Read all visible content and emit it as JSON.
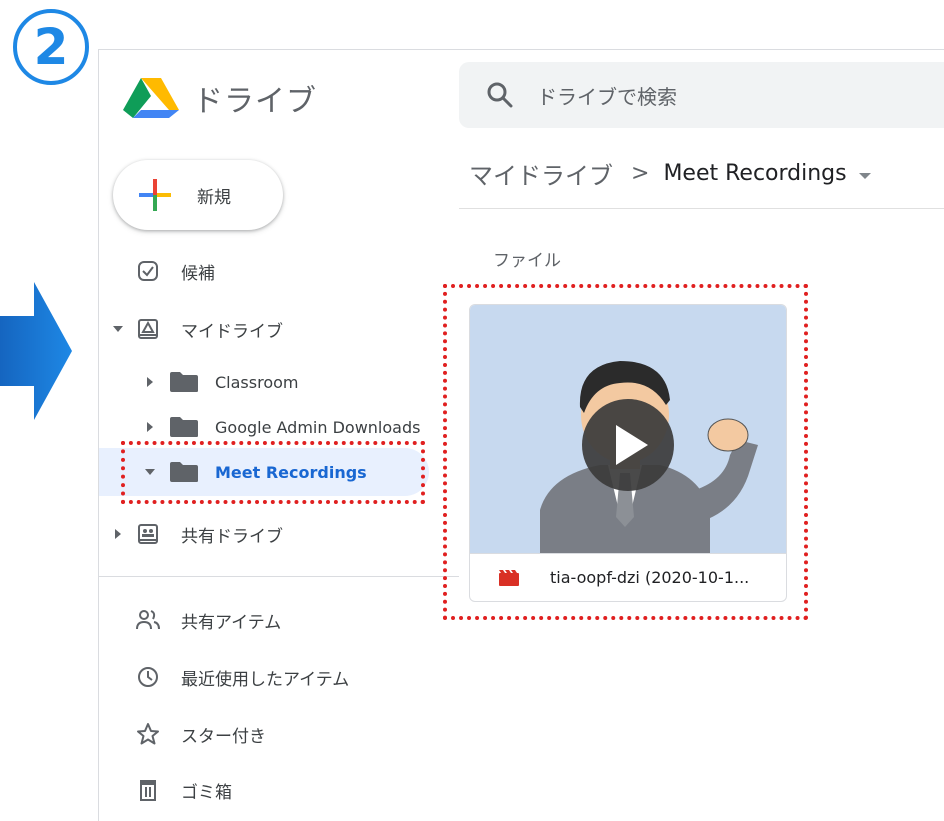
{
  "step": {
    "number": "2"
  },
  "app": {
    "title": "ドライブ"
  },
  "search": {
    "placeholder": "ドライブで検索"
  },
  "new_button": {
    "label": "新規"
  },
  "nav": {
    "suggested": "候補",
    "my_drive": "マイドライブ",
    "folders": [
      {
        "label": "Classroom",
        "expanded": false
      },
      {
        "label": "Google Admin Downloads",
        "expanded": false
      },
      {
        "label": "Meet Recordings",
        "expanded": true,
        "selected": true
      }
    ],
    "shared_drives": "共有ドライブ",
    "shared_with_me": "共有アイテム",
    "recent": "最近使用したアイテム",
    "starred": "スター付き",
    "trash": "ゴミ箱"
  },
  "breadcrumb": {
    "root": "マイドライブ",
    "separator": ">",
    "current": "Meet Recordings"
  },
  "files_section": {
    "label": "ファイル"
  },
  "files": [
    {
      "name": "tia-oopf-dzi (2020-10-1...",
      "type": "video"
    }
  ],
  "colors": {
    "accent": "#1a73e8",
    "highlight": "#e02020",
    "step": "#1e88e5",
    "selected_bg": "#e8f0fe"
  }
}
